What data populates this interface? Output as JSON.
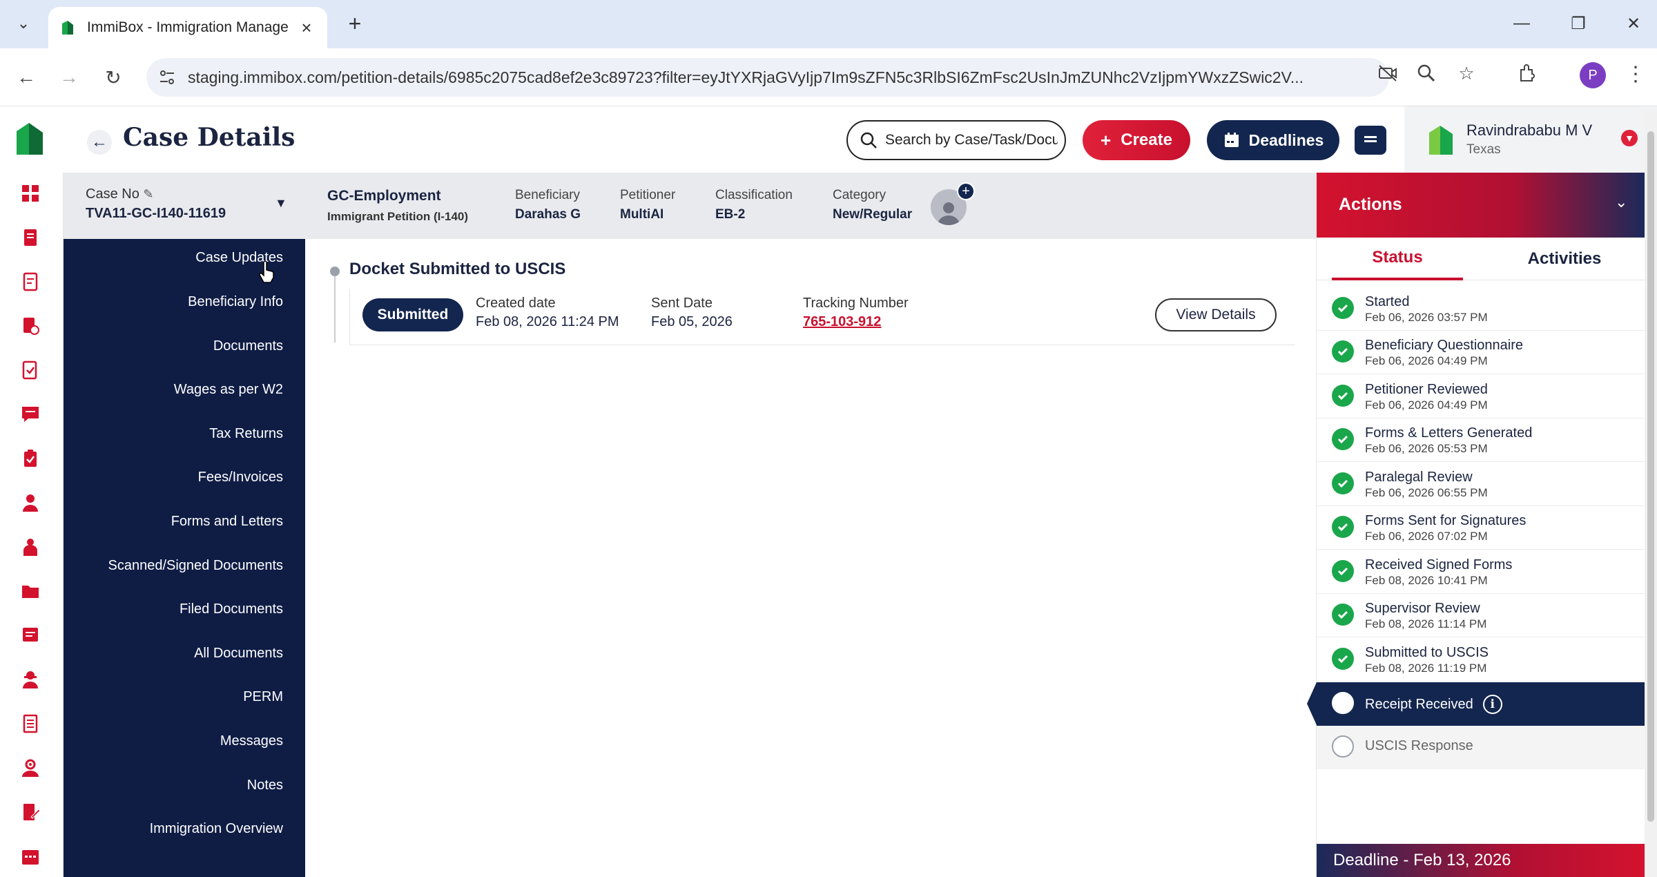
{
  "browser": {
    "tab_title": "ImmiBox - Immigration Manage",
    "url": "staging.immibox.com/petition-details/6985c2075cad8ef2e3c89723?filter=eyJtYXRjaGVyIjp7Im9sZFN5c3RlbSI6ZmFsc2UsInJmZUNhc2VzIjpmYWxzZSwic2V...",
    "profile_initial": "P"
  },
  "header": {
    "title": "Case Details",
    "search_placeholder": "Search by Case/Task/Document",
    "create_label": "Create",
    "deadlines_label": "Deadlines",
    "user_name": "Ravindrababu M V",
    "user_location": "Texas"
  },
  "case": {
    "case_no_label": "Case No",
    "case_no": "TVA11-GC-I140-11619",
    "type": "GC-Employment",
    "subtype": "Immigrant Petition (I-140)",
    "fields": [
      {
        "label": "Beneficiary",
        "value": "Darahas G"
      },
      {
        "label": "Petitioner",
        "value": "MultiAI"
      },
      {
        "label": "Classification",
        "value": "EB-2"
      },
      {
        "label": "Category",
        "value": "New/Regular"
      }
    ]
  },
  "sections": [
    "Case Updates",
    "Beneficiary Info",
    "Documents",
    "Wages as per W2",
    "Tax Returns",
    "Fees/Invoices",
    "Forms and Letters",
    "Scanned/Signed Documents",
    "Filed Documents",
    "All Documents",
    "PERM",
    "Messages",
    "Notes",
    "Immigration Overview"
  ],
  "docket": {
    "title": "Docket Submitted to USCIS",
    "status": "Submitted",
    "created_label": "Created date",
    "created_value": "Feb 08, 2026 11:24 PM",
    "sent_label": "Sent Date",
    "sent_value": "Feb 05, 2026",
    "tracking_label": "Tracking Number",
    "tracking_value": "765-103-912",
    "view_label": "View Details"
  },
  "actions": {
    "title": "Actions",
    "tab_status": "Status",
    "tab_activities": "Activities",
    "steps": [
      {
        "name": "Started",
        "date": "Feb 06, 2026 03:57 PM"
      },
      {
        "name": "Beneficiary Questionnaire",
        "date": "Feb 06, 2026 04:49 PM"
      },
      {
        "name": "Petitioner Reviewed",
        "date": "Feb 06, 2026 04:49 PM"
      },
      {
        "name": "Forms & Letters Generated",
        "date": "Feb 06, 2026 05:53 PM"
      },
      {
        "name": "Paralegal Review",
        "date": "Feb 06, 2026 06:55 PM"
      },
      {
        "name": "Forms Sent for Signatures",
        "date": "Feb 06, 2026 07:02 PM"
      },
      {
        "name": "Received Signed Forms",
        "date": "Feb 08, 2026 10:41 PM"
      },
      {
        "name": "Supervisor Review",
        "date": "Feb 08, 2026 11:14 PM"
      },
      {
        "name": "Submitted to USCIS",
        "date": "Feb 08, 2026 11:19 PM"
      }
    ],
    "current_step": "Receipt Received",
    "pending_step": "USCIS Response",
    "deadline": "Deadline - Feb 13, 2026"
  },
  "colors": {
    "navy": "#13264f",
    "sidebar": "#0f1d45",
    "accent_red": "#c8102e",
    "success_green": "#1aa64a"
  }
}
